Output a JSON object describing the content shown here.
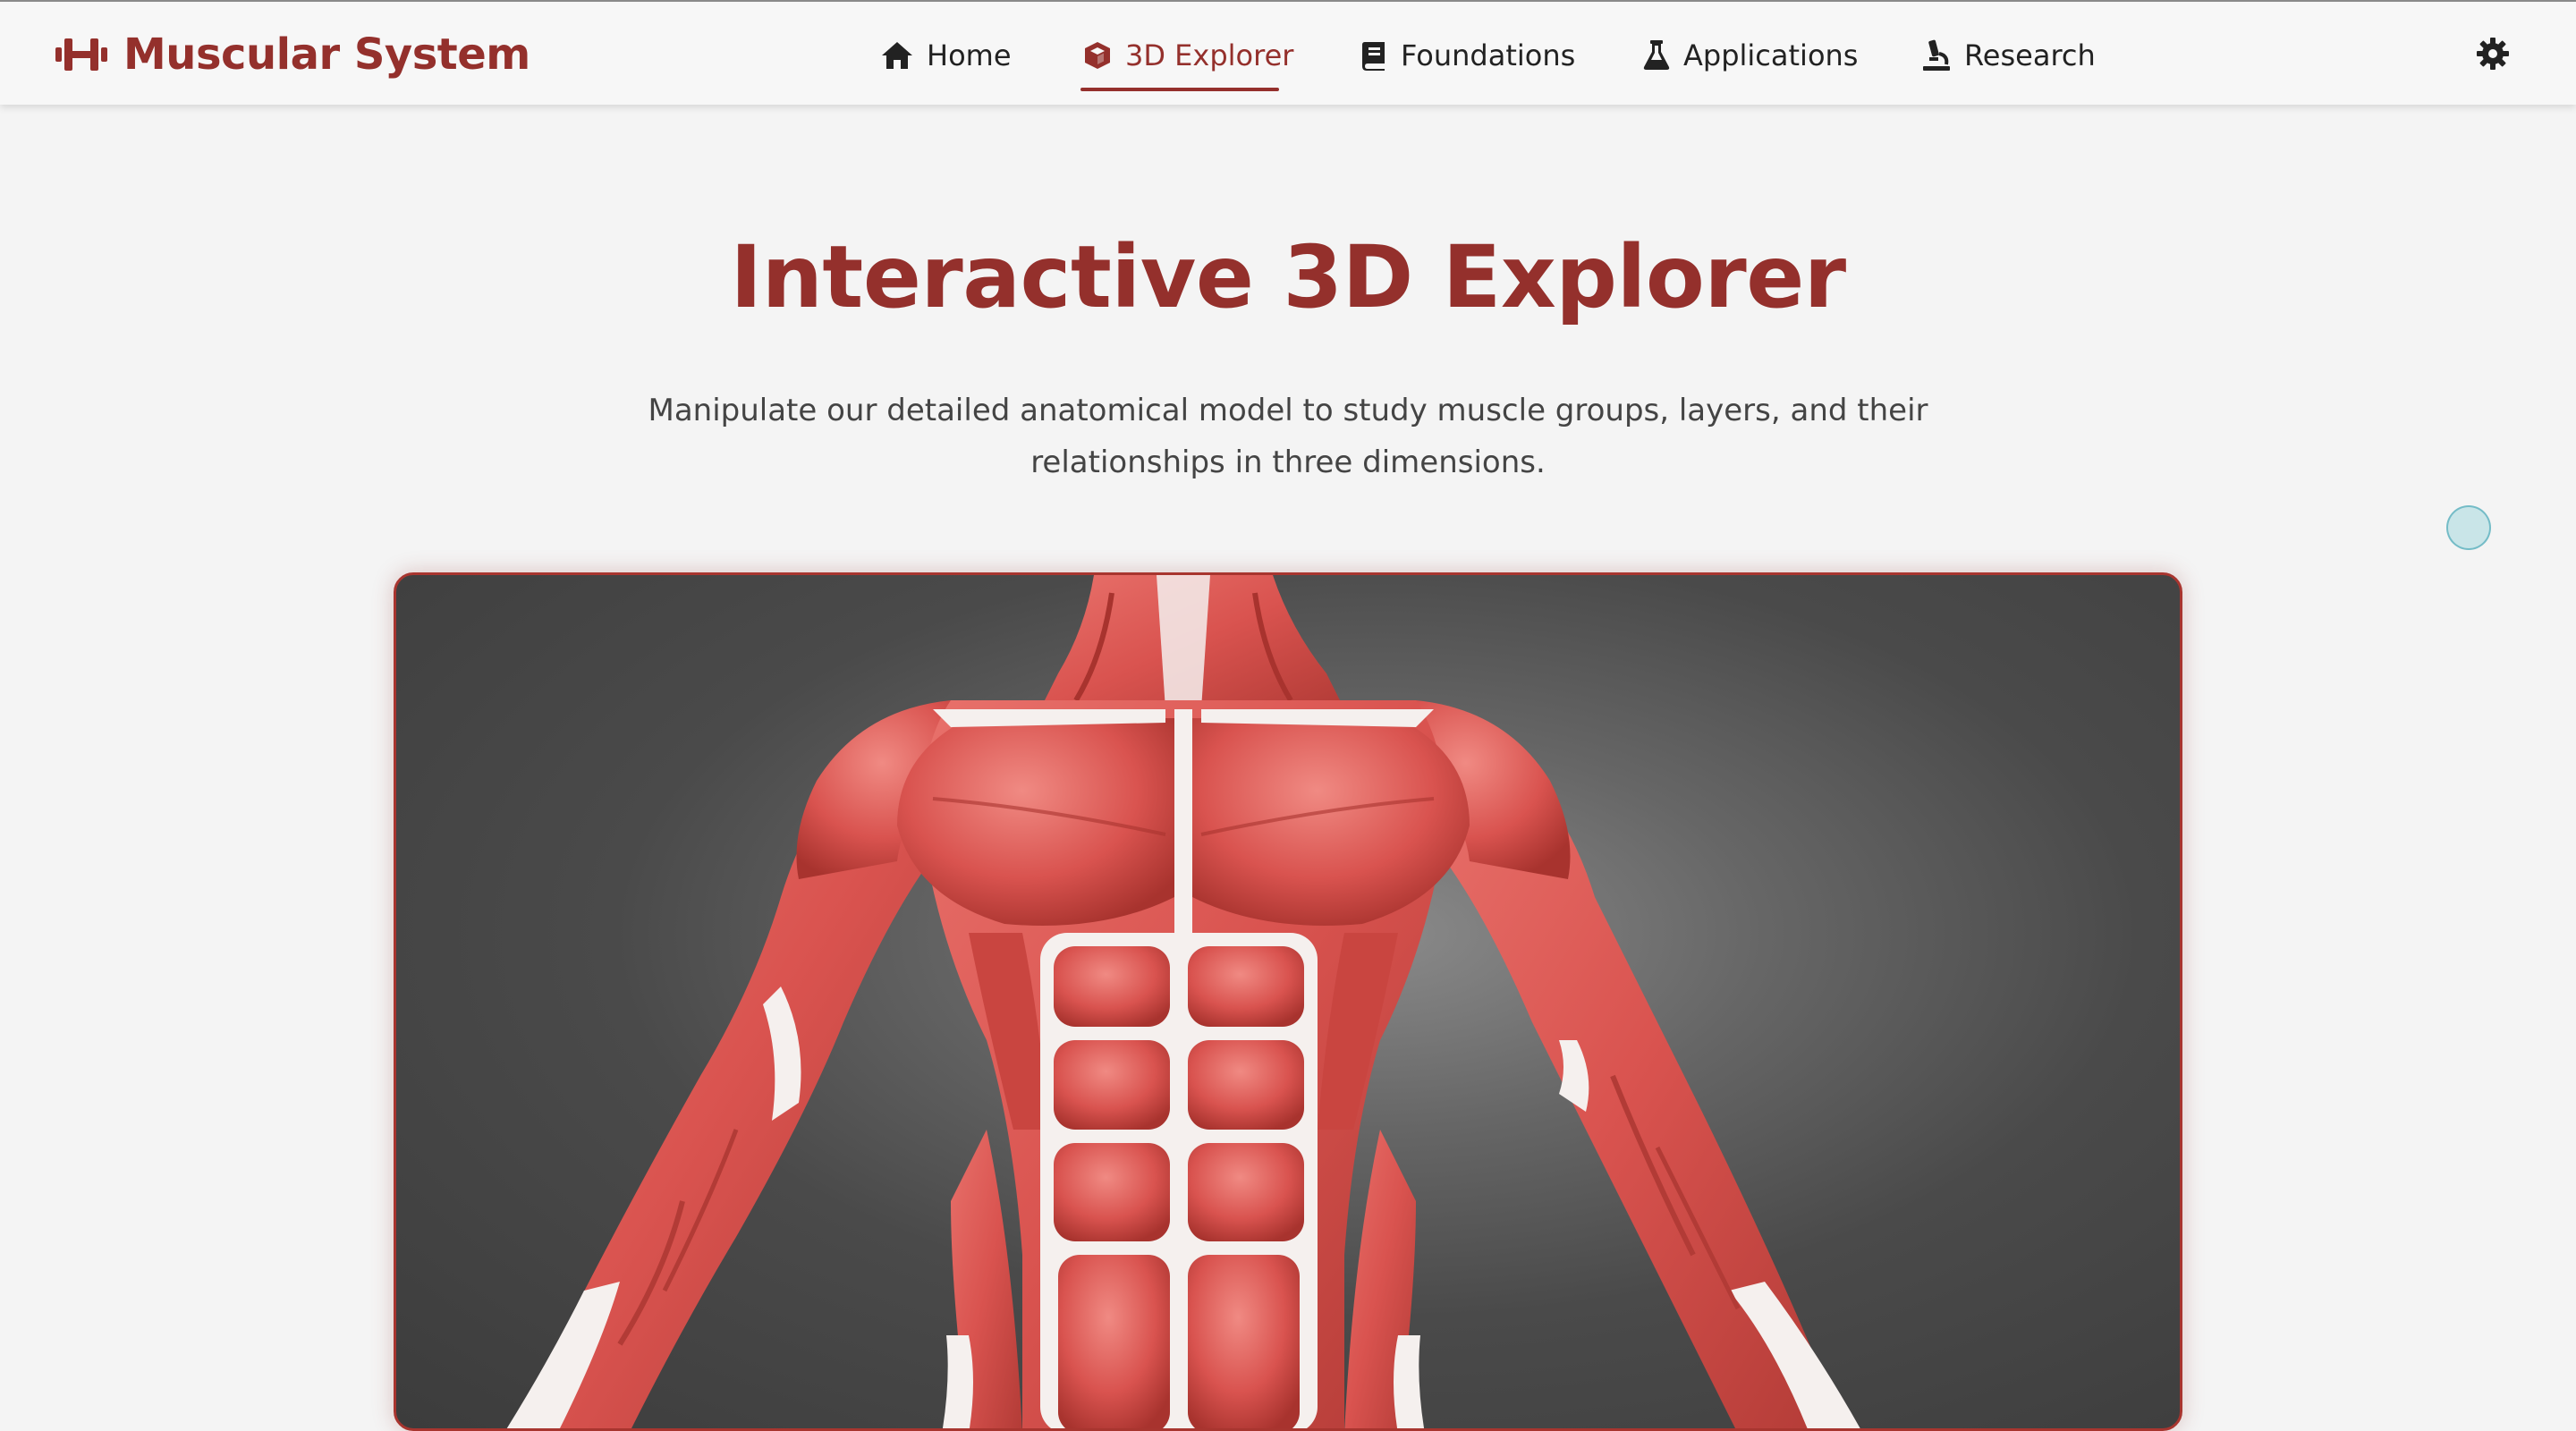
{
  "brand": {
    "title": "Muscular System",
    "icon": "dumbbell-icon",
    "color": "#94302c"
  },
  "nav": {
    "items": [
      {
        "label": "Home",
        "icon": "home-icon"
      },
      {
        "label": "3D Explorer",
        "icon": "cube-icon",
        "active": true
      },
      {
        "label": "Foundations",
        "icon": "book-icon"
      },
      {
        "label": "Applications",
        "icon": "flask-icon"
      },
      {
        "label": "Research",
        "icon": "microscope-icon"
      }
    ],
    "settings_icon": "gear-icon"
  },
  "hero": {
    "title": "Interactive 3D Explorer",
    "subtitle": "Manipulate our detailed anatomical model to study muscle groups, layers, and their relationships in three dimensions."
  },
  "viewer": {
    "model": "human torso muscular anatomy model",
    "muscle_color": "#d9534f",
    "tendon_color": "#f5f0ee",
    "background_color": "#4a4a4a"
  },
  "colors": {
    "accent": "#94302c",
    "page_bg": "#f4f4f4",
    "nav_bg": "#f7f7f7"
  }
}
